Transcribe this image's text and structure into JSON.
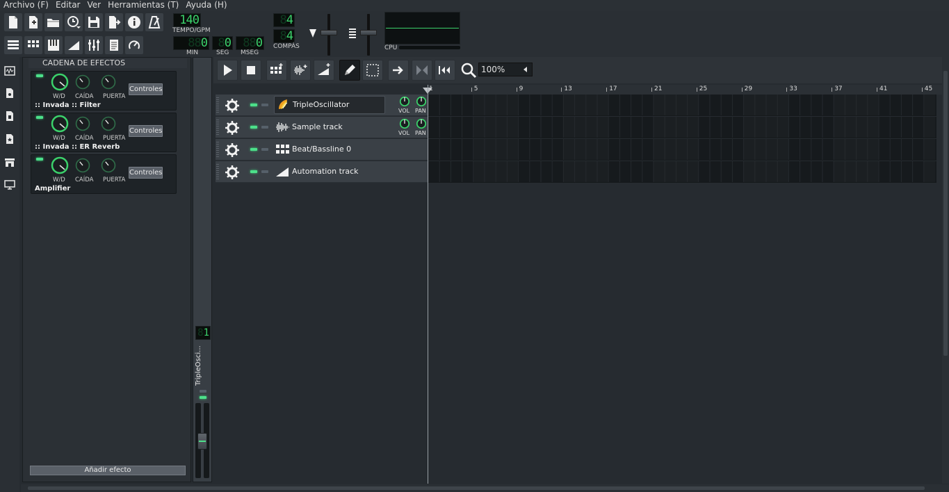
{
  "menu": [
    "Archivo (F)",
    "Editar",
    "Ver",
    "Herramientas (T)",
    "Ayuda (H)"
  ],
  "toolbar": {
    "tempo_value": "140",
    "tempo_label": "TEMPO/GPM",
    "min_value": "0",
    "min_label": "MIN",
    "seg_value": "0",
    "seg_label": "SEG",
    "mseg_value": "0",
    "mseg_label": "MSEG",
    "timesig_num": "4",
    "timesig_den": "4",
    "compas_label": "COMPÁS",
    "cpu_label": "CPU",
    "buttons": [
      "new-project",
      "new-from-template",
      "open-project",
      "recent-projects",
      "save-project",
      "export",
      "what-is-this",
      "metronome"
    ],
    "window_buttons": [
      "song-editor",
      "beat-bassline-editor",
      "piano-roll",
      "automation-editor",
      "fx-mixer",
      "project-notes",
      "controller-rack"
    ]
  },
  "sidebar": [
    "my-samples",
    "my-presets",
    "my-projects",
    "my-favorites",
    "my-home",
    "root-directory"
  ],
  "fx_chain": {
    "title": "CADENA DE EFECTOS",
    "knob_labels": [
      "W/D",
      "CAÍDA",
      "PUERTA"
    ],
    "controls_label": "Controles",
    "units": [
      {
        "name": ":: Invada :: Filter"
      },
      {
        "name": ":: Invada :: ER Reverb"
      },
      {
        "name": "Amplifier"
      }
    ],
    "add_effect_label": "Añadir efecto"
  },
  "mixer_strip": {
    "channel_value": "1",
    "channel_name": "TripleOsci..."
  },
  "song_editor": {
    "zoom": "100%",
    "bar_numbers": [
      "1",
      "5",
      "9",
      "13",
      "17",
      "21",
      "25",
      "29",
      "33",
      "37",
      "41",
      "45"
    ],
    "tracks": [
      {
        "name": "TripleOscillator",
        "type": "instrument",
        "has_knobs": true
      },
      {
        "name": "Sample track",
        "type": "sample",
        "has_knobs": true
      },
      {
        "name": "Beat/Bassline 0",
        "type": "beat-bassline",
        "has_knobs": false
      },
      {
        "name": "Automation track",
        "type": "automation",
        "has_knobs": false
      }
    ],
    "vol_label": "VOL",
    "pan_label": "PAN"
  },
  "colors": {
    "lcd_green": "#3bd26b",
    "led_green": "#4ce08a",
    "background": "#262b30"
  }
}
